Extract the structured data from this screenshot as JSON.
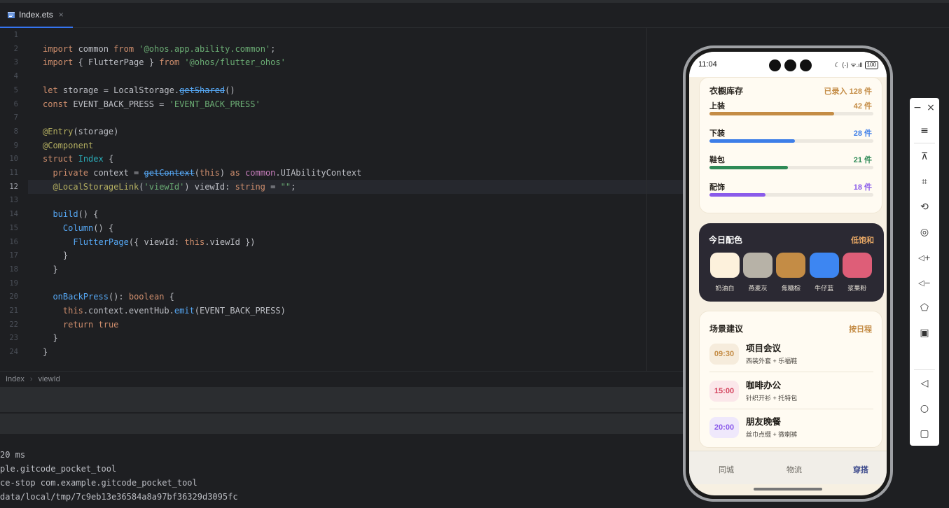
{
  "tab": {
    "filename": "Index.ets",
    "close": "×"
  },
  "editor": {
    "line_numbers": [
      "1",
      "2",
      "3",
      "4",
      "5",
      "6",
      "7",
      "8",
      "9",
      "10",
      "11",
      "12",
      "13",
      "14",
      "15",
      "16",
      "17",
      "18",
      "19",
      "20",
      "21",
      "22",
      "23",
      "24"
    ],
    "current_line": 12,
    "lines": [
      [],
      [
        {
          "t": "import",
          "c": "kw"
        },
        {
          "t": " common "
        },
        {
          "t": "from",
          "c": "kw"
        },
        {
          "t": " "
        },
        {
          "t": "'@ohos.app.ability.common'",
          "c": "str"
        },
        {
          "t": ";"
        }
      ],
      [
        {
          "t": "import",
          "c": "kw"
        },
        {
          "t": " { FlutterPage } "
        },
        {
          "t": "from",
          "c": "kw"
        },
        {
          "t": " "
        },
        {
          "t": "'@ohos/flutter_ohos'",
          "c": "str"
        }
      ],
      [],
      [
        {
          "t": "let",
          "c": "kw"
        },
        {
          "t": " storage = LocalStorage."
        },
        {
          "t": "getShared",
          "c": "dep"
        },
        {
          "t": "()"
        }
      ],
      [
        {
          "t": "const",
          "c": "kw"
        },
        {
          "t": " EVENT_BACK_PRESS = "
        },
        {
          "t": "'EVENT_BACK_PRESS'",
          "c": "str"
        }
      ],
      [],
      [
        {
          "t": "@Entry",
          "c": "ann"
        },
        {
          "t": "(storage)"
        }
      ],
      [
        {
          "t": "@Component",
          "c": "ann"
        }
      ],
      [
        {
          "t": "struct",
          "c": "kw"
        },
        {
          "t": " "
        },
        {
          "t": "Index",
          "c": "cls"
        },
        {
          "t": " {"
        }
      ],
      [
        {
          "t": "  "
        },
        {
          "t": "private",
          "c": "kw"
        },
        {
          "t": " context = "
        },
        {
          "t": "getContext",
          "c": "dep"
        },
        {
          "t": "("
        },
        {
          "t": "this",
          "c": "kw"
        },
        {
          "t": ") "
        },
        {
          "t": "as",
          "c": "kw"
        },
        {
          "t": " "
        },
        {
          "t": "common",
          "c": "typ"
        },
        {
          "t": ".UIAbilityContext"
        }
      ],
      [
        {
          "t": "  "
        },
        {
          "t": "@LocalStorageLink",
          "c": "ann"
        },
        {
          "t": "("
        },
        {
          "t": "'viewId'",
          "c": "str"
        },
        {
          "t": ") viewId: "
        },
        {
          "t": "string",
          "c": "kw"
        },
        {
          "t": " = "
        },
        {
          "t": "\"\"",
          "c": "str"
        },
        {
          "t": ";"
        }
      ],
      [],
      [
        {
          "t": "  "
        },
        {
          "t": "build",
          "c": "fn"
        },
        {
          "t": "() {"
        }
      ],
      [
        {
          "t": "    "
        },
        {
          "t": "Column",
          "c": "fn"
        },
        {
          "t": "() {"
        }
      ],
      [
        {
          "t": "      "
        },
        {
          "t": "FlutterPage",
          "c": "fn"
        },
        {
          "t": "({ viewId: "
        },
        {
          "t": "this",
          "c": "kw"
        },
        {
          "t": ".viewId })"
        }
      ],
      [
        {
          "t": "    }"
        }
      ],
      [
        {
          "t": "  }"
        }
      ],
      [],
      [
        {
          "t": "  "
        },
        {
          "t": "onBackPress",
          "c": "fn"
        },
        {
          "t": "(): "
        },
        {
          "t": "boolean",
          "c": "kw"
        },
        {
          "t": " {"
        }
      ],
      [
        {
          "t": "    "
        },
        {
          "t": "this",
          "c": "kw"
        },
        {
          "t": ".context.eventHub."
        },
        {
          "t": "emit",
          "c": "fn"
        },
        {
          "t": "(EVENT_BACK_PRESS)"
        }
      ],
      [
        {
          "t": "    "
        },
        {
          "t": "return",
          "c": "kw"
        },
        {
          "t": " "
        },
        {
          "t": "true",
          "c": "kw"
        }
      ],
      [
        {
          "t": "  }"
        }
      ],
      [
        {
          "t": "}"
        }
      ]
    ]
  },
  "breadcrumb": {
    "items": [
      "Index",
      "viewId"
    ],
    "separator": "›"
  },
  "console": {
    "lines": [
      "20 ms",
      "ple.gitcode_pocket_tool",
      "ce-stop com.example.gitcode_pocket_tool",
      "data/local/tmp/7c9eb13e36584a8a97bf36329d3095fc"
    ]
  },
  "phone": {
    "status": {
      "time": "11:04",
      "icons": "☾ ⟨·⟩ ᯤ.ıll",
      "battery": "100"
    },
    "wardrobe": {
      "title": "衣橱库存",
      "summary": "已录入 128 件",
      "bars": [
        {
          "label": "上装",
          "value": "42 件",
          "fraction": 0.76,
          "color": "#c48c45"
        },
        {
          "label": "下装",
          "value": "28 件",
          "fraction": 0.52,
          "color": "#3d7ee8"
        },
        {
          "label": "鞋包",
          "value": "21 件",
          "fraction": 0.48,
          "color": "#2e8a56"
        },
        {
          "label": "配饰",
          "value": "18 件",
          "fraction": 0.34,
          "color": "#8a5bea"
        }
      ]
    },
    "palette": {
      "title": "今日配色",
      "tag": "低饱和",
      "swatches": [
        {
          "label": "奶油白",
          "color": "#fdf1dc"
        },
        {
          "label": "燕麦灰",
          "color": "#b7b2a7"
        },
        {
          "label": "焦糖棕",
          "color": "#c48c45"
        },
        {
          "label": "牛仔蓝",
          "color": "#3d86f2"
        },
        {
          "label": "浆果粉",
          "color": "#de5e78"
        }
      ]
    },
    "scenes": {
      "title": "场景建议",
      "action": "按日程",
      "items": [
        {
          "time": "09:30",
          "title": "项目会议",
          "sub": "西装外套 + 乐福鞋",
          "fg": "#c48c45",
          "bg": "#f6ecdc"
        },
        {
          "time": "15:00",
          "title": "咖啡办公",
          "sub": "针织开衫 + 托特包",
          "fg": "#d4445e",
          "bg": "#fbe7ea"
        },
        {
          "time": "20:00",
          "title": "朋友晚餐",
          "sub": "丝巾点缀 + 微喇裤",
          "fg": "#8a5bea",
          "bg": "#efe8fb"
        }
      ]
    },
    "nav": {
      "items": [
        "同城",
        "物流",
        "穿搭"
      ],
      "active": 2
    }
  },
  "toolbar": {
    "items": [
      "−",
      "×",
      "≡",
      "⊼",
      "⌗",
      "⟲",
      "◎",
      "◁+",
      "◁−",
      "⬠",
      "▣",
      "◁",
      "○",
      "▢"
    ]
  }
}
